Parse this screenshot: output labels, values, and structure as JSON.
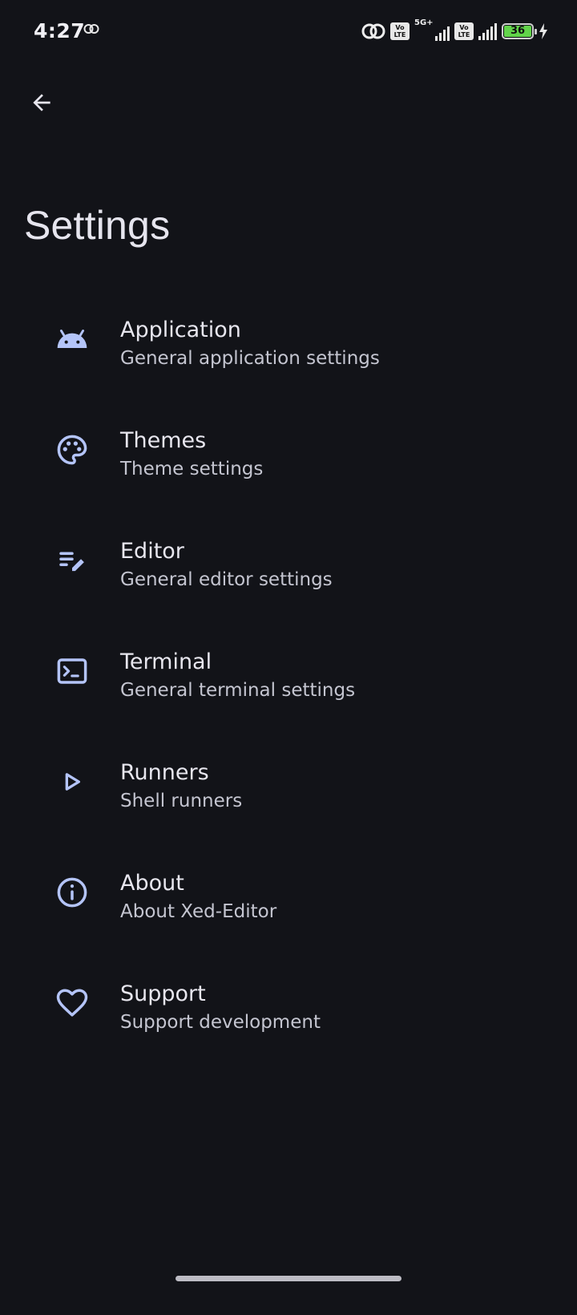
{
  "status_bar": {
    "time": "4:27",
    "volte_label": "Vo LTE",
    "network_label": "5G+",
    "battery_level": "36",
    "icons": [
      "link-icon",
      "hotspot-icon",
      "volte-icon",
      "signal-icon",
      "battery-icon",
      "charging-icon"
    ]
  },
  "app_bar": {
    "back_icon": "arrow-back-icon",
    "title": "Settings"
  },
  "settings": {
    "items": [
      {
        "icon": "android-icon",
        "title": "Application",
        "subtitle": "General application settings"
      },
      {
        "icon": "palette-icon",
        "title": "Themes",
        "subtitle": "Theme settings"
      },
      {
        "icon": "edit-note-icon",
        "title": "Editor",
        "subtitle": "General editor settings"
      },
      {
        "icon": "terminal-icon",
        "title": "Terminal",
        "subtitle": "General terminal settings"
      },
      {
        "icon": "play-icon",
        "title": "Runners",
        "subtitle": "Shell runners"
      },
      {
        "icon": "info-icon",
        "title": "About",
        "subtitle": "About Xed-Editor"
      },
      {
        "icon": "heart-icon",
        "title": "Support",
        "subtitle": "Support development"
      }
    ]
  },
  "colors": {
    "background": "#121318",
    "accent_icon": "#b4c4f8",
    "title_text": "#e7e6ee",
    "subtitle_text": "#c4c5d0",
    "battery_fill": "#62d44a"
  }
}
